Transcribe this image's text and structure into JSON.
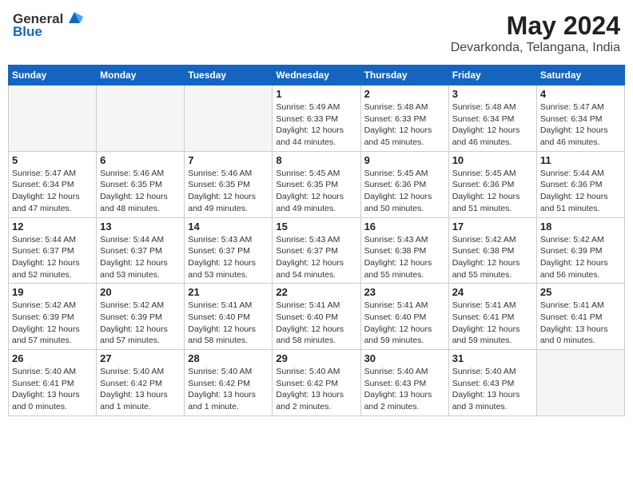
{
  "header": {
    "logo_general": "General",
    "logo_blue": "Blue",
    "month": "May 2024",
    "location": "Devarkonda, Telangana, India"
  },
  "weekdays": [
    "Sunday",
    "Monday",
    "Tuesday",
    "Wednesday",
    "Thursday",
    "Friday",
    "Saturday"
  ],
  "weeks": [
    [
      {
        "day": "",
        "info": ""
      },
      {
        "day": "",
        "info": ""
      },
      {
        "day": "",
        "info": ""
      },
      {
        "day": "1",
        "info": "Sunrise: 5:49 AM\nSunset: 6:33 PM\nDaylight: 12 hours\nand 44 minutes."
      },
      {
        "day": "2",
        "info": "Sunrise: 5:48 AM\nSunset: 6:33 PM\nDaylight: 12 hours\nand 45 minutes."
      },
      {
        "day": "3",
        "info": "Sunrise: 5:48 AM\nSunset: 6:34 PM\nDaylight: 12 hours\nand 46 minutes."
      },
      {
        "day": "4",
        "info": "Sunrise: 5:47 AM\nSunset: 6:34 PM\nDaylight: 12 hours\nand 46 minutes."
      }
    ],
    [
      {
        "day": "5",
        "info": "Sunrise: 5:47 AM\nSunset: 6:34 PM\nDaylight: 12 hours\nand 47 minutes."
      },
      {
        "day": "6",
        "info": "Sunrise: 5:46 AM\nSunset: 6:35 PM\nDaylight: 12 hours\nand 48 minutes."
      },
      {
        "day": "7",
        "info": "Sunrise: 5:46 AM\nSunset: 6:35 PM\nDaylight: 12 hours\nand 49 minutes."
      },
      {
        "day": "8",
        "info": "Sunrise: 5:45 AM\nSunset: 6:35 PM\nDaylight: 12 hours\nand 49 minutes."
      },
      {
        "day": "9",
        "info": "Sunrise: 5:45 AM\nSunset: 6:36 PM\nDaylight: 12 hours\nand 50 minutes."
      },
      {
        "day": "10",
        "info": "Sunrise: 5:45 AM\nSunset: 6:36 PM\nDaylight: 12 hours\nand 51 minutes."
      },
      {
        "day": "11",
        "info": "Sunrise: 5:44 AM\nSunset: 6:36 PM\nDaylight: 12 hours\nand 51 minutes."
      }
    ],
    [
      {
        "day": "12",
        "info": "Sunrise: 5:44 AM\nSunset: 6:37 PM\nDaylight: 12 hours\nand 52 minutes."
      },
      {
        "day": "13",
        "info": "Sunrise: 5:44 AM\nSunset: 6:37 PM\nDaylight: 12 hours\nand 53 minutes."
      },
      {
        "day": "14",
        "info": "Sunrise: 5:43 AM\nSunset: 6:37 PM\nDaylight: 12 hours\nand 53 minutes."
      },
      {
        "day": "15",
        "info": "Sunrise: 5:43 AM\nSunset: 6:37 PM\nDaylight: 12 hours\nand 54 minutes."
      },
      {
        "day": "16",
        "info": "Sunrise: 5:43 AM\nSunset: 6:38 PM\nDaylight: 12 hours\nand 55 minutes."
      },
      {
        "day": "17",
        "info": "Sunrise: 5:42 AM\nSunset: 6:38 PM\nDaylight: 12 hours\nand 55 minutes."
      },
      {
        "day": "18",
        "info": "Sunrise: 5:42 AM\nSunset: 6:39 PM\nDaylight: 12 hours\nand 56 minutes."
      }
    ],
    [
      {
        "day": "19",
        "info": "Sunrise: 5:42 AM\nSunset: 6:39 PM\nDaylight: 12 hours\nand 57 minutes."
      },
      {
        "day": "20",
        "info": "Sunrise: 5:42 AM\nSunset: 6:39 PM\nDaylight: 12 hours\nand 57 minutes."
      },
      {
        "day": "21",
        "info": "Sunrise: 5:41 AM\nSunset: 6:40 PM\nDaylight: 12 hours\nand 58 minutes."
      },
      {
        "day": "22",
        "info": "Sunrise: 5:41 AM\nSunset: 6:40 PM\nDaylight: 12 hours\nand 58 minutes."
      },
      {
        "day": "23",
        "info": "Sunrise: 5:41 AM\nSunset: 6:40 PM\nDaylight: 12 hours\nand 59 minutes."
      },
      {
        "day": "24",
        "info": "Sunrise: 5:41 AM\nSunset: 6:41 PM\nDaylight: 12 hours\nand 59 minutes."
      },
      {
        "day": "25",
        "info": "Sunrise: 5:41 AM\nSunset: 6:41 PM\nDaylight: 13 hours\nand 0 minutes."
      }
    ],
    [
      {
        "day": "26",
        "info": "Sunrise: 5:40 AM\nSunset: 6:41 PM\nDaylight: 13 hours\nand 0 minutes."
      },
      {
        "day": "27",
        "info": "Sunrise: 5:40 AM\nSunset: 6:42 PM\nDaylight: 13 hours\nand 1 minute."
      },
      {
        "day": "28",
        "info": "Sunrise: 5:40 AM\nSunset: 6:42 PM\nDaylight: 13 hours\nand 1 minute."
      },
      {
        "day": "29",
        "info": "Sunrise: 5:40 AM\nSunset: 6:42 PM\nDaylight: 13 hours\nand 2 minutes."
      },
      {
        "day": "30",
        "info": "Sunrise: 5:40 AM\nSunset: 6:43 PM\nDaylight: 13 hours\nand 2 minutes."
      },
      {
        "day": "31",
        "info": "Sunrise: 5:40 AM\nSunset: 6:43 PM\nDaylight: 13 hours\nand 3 minutes."
      },
      {
        "day": "",
        "info": ""
      }
    ]
  ]
}
